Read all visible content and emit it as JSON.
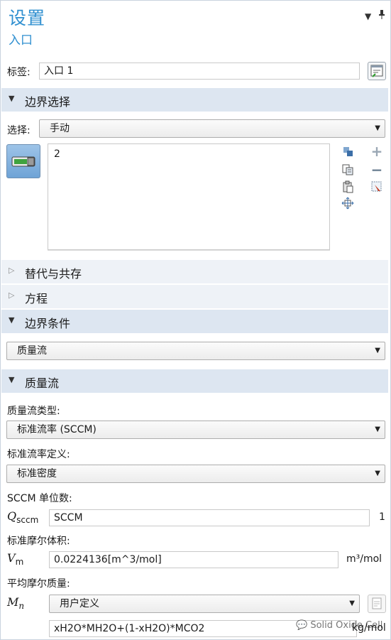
{
  "header": {
    "title": "设置",
    "subtitle": "入口",
    "pin_icon": "pin-icon",
    "menu_icon": "triangle-down-icon"
  },
  "label_row": {
    "label": "标签:",
    "value": "入口 1"
  },
  "boundary_selection": {
    "section_title": "边界选择",
    "select_label": "选择:",
    "select_value": "手动",
    "list_value": "2"
  },
  "sections": {
    "override": "替代与共存",
    "equation": "方程",
    "boundary_condition": "边界条件",
    "mass_flow": "质量流"
  },
  "boundary_condition": {
    "value": "质量流"
  },
  "mass_flow": {
    "type_label": "质量流类型:",
    "type_value": "标准流率 (SCCM)",
    "std_def_label": "标准流率定义:",
    "std_def_value": "标准密度",
    "sccm_label": "SCCM 单位数:",
    "q_symbol": "Q",
    "q_sub": "sccm",
    "q_value": "SCCM",
    "q_unit": "1",
    "vm_label": "标准摩尔体积:",
    "vm_symbol": "V",
    "vm_sub": "m",
    "vm_value": "0.0224136[m^3/mol]",
    "vm_unit": "m³/mol",
    "mn_label": "平均摩尔质量:",
    "mn_symbol": "M",
    "mn_sub": "n",
    "mn_select": "用户定义",
    "mn_expr": "xH2O*MH2O+(1-xH2O)*MCO2",
    "mn_unit": "kg/mol"
  },
  "watermark": "Solid Oxide Cell"
}
